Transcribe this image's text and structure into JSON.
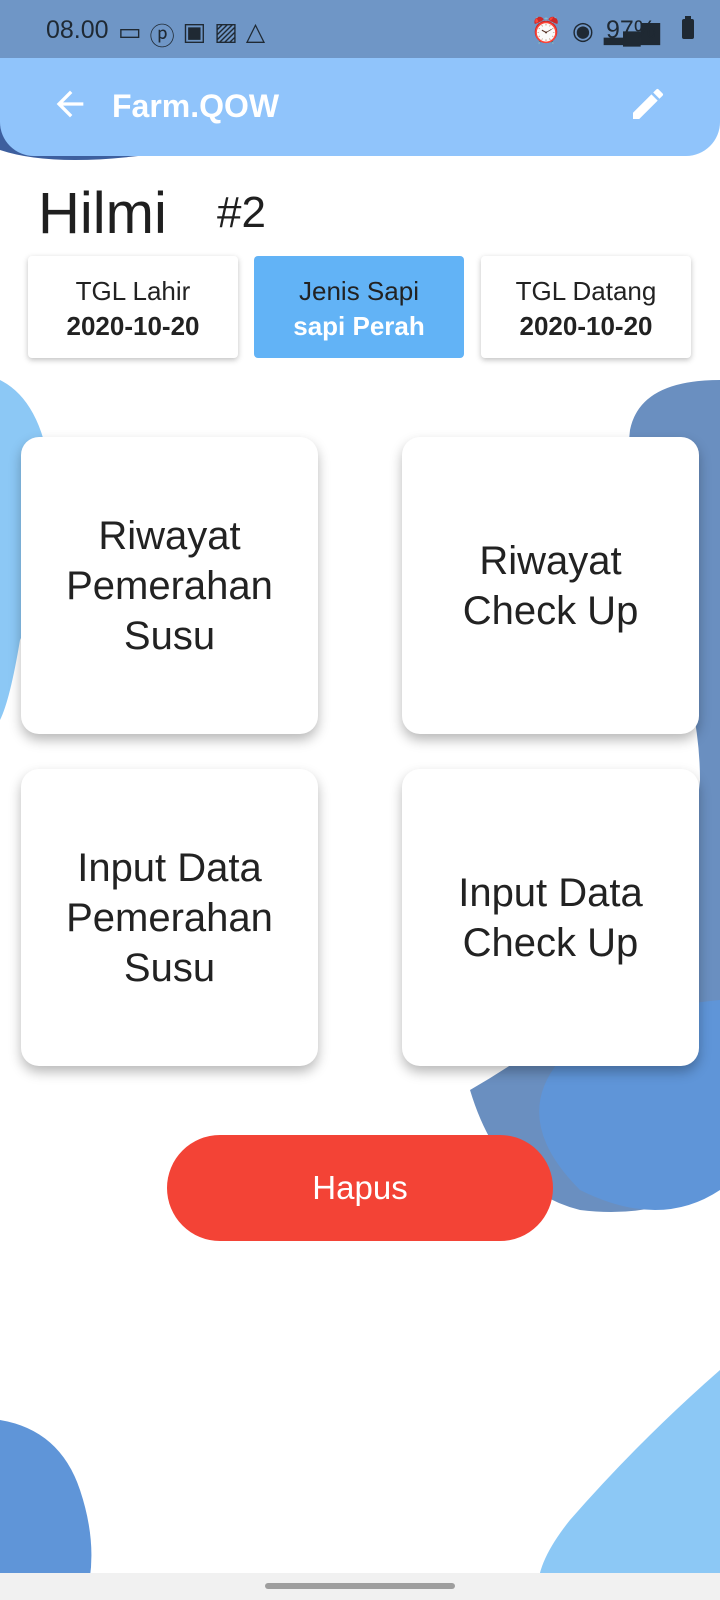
{
  "status_bar": {
    "time": "08.00",
    "battery": "97%",
    "left_icons": [
      "video-icon",
      "pinterest-icon",
      "camera-icon",
      "image-icon",
      "drive-icon"
    ],
    "right_icons": [
      "alarm-icon",
      "hotspot-icon",
      "4g-icon",
      "signal-icon",
      "battery-icon"
    ]
  },
  "app_bar": {
    "title": "Farm.QOW",
    "background": "#90c4fb",
    "back_icon": "arrow-left-icon",
    "edit_icon": "pencil-icon"
  },
  "cow": {
    "name": "Hilmi",
    "number": "#2"
  },
  "info_cards": [
    {
      "label": "TGL Lahir",
      "value": "2020-10-20",
      "selected": false
    },
    {
      "label": "Jenis Sapi",
      "value": "sapi Perah",
      "selected": true
    },
    {
      "label": "TGL Datang",
      "value": "2020-10-20",
      "selected": false
    }
  ],
  "menu": {
    "riwayat_pemerahan": [
      "Riwayat",
      "Pemerahan",
      "Susu"
    ],
    "riwayat_checkup": [
      "Riwayat",
      "Check Up"
    ],
    "input_pemerahan": [
      "Input Data",
      "Pemerahan",
      "Susu"
    ],
    "input_checkup": [
      "Input Data",
      "Check Up"
    ]
  },
  "actions": {
    "delete_label": "Hapus",
    "delete_color": "#f34336"
  },
  "colors": {
    "accent": "#62b3f6",
    "blob_dark": "#6a8fc0",
    "blob_light": "#8cc8f5"
  }
}
